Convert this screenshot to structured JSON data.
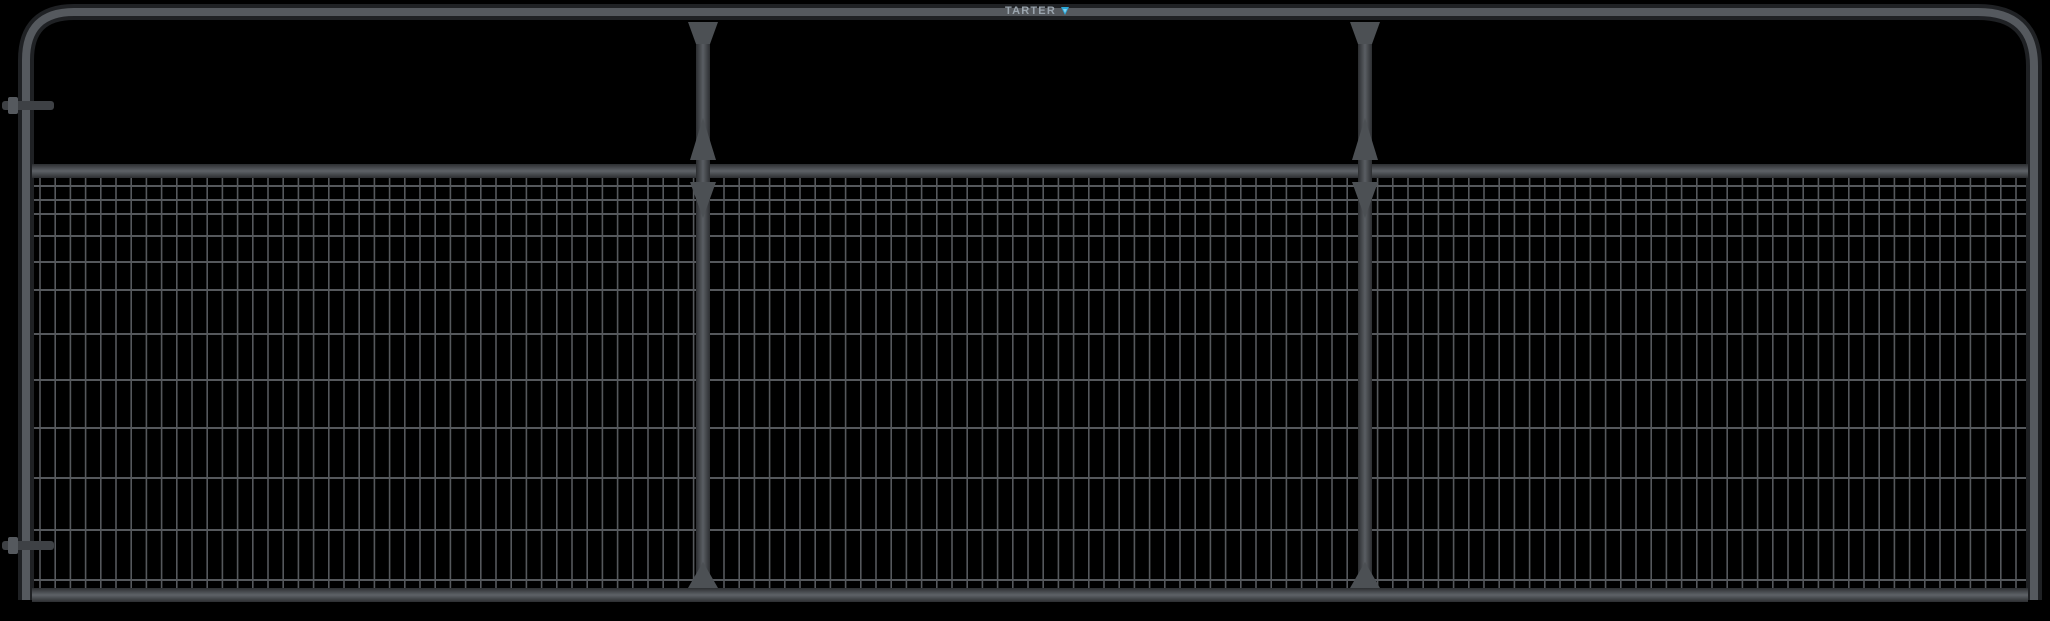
{
  "brand": {
    "name": "TARTER",
    "mark_icon": "tarter-logo-mark-icon",
    "mark_color": "#2aa7d8"
  },
  "gate": {
    "tube_color": "#4a4d51",
    "tube_highlight": "#6b6f74",
    "wire_color": "#55585c"
  }
}
